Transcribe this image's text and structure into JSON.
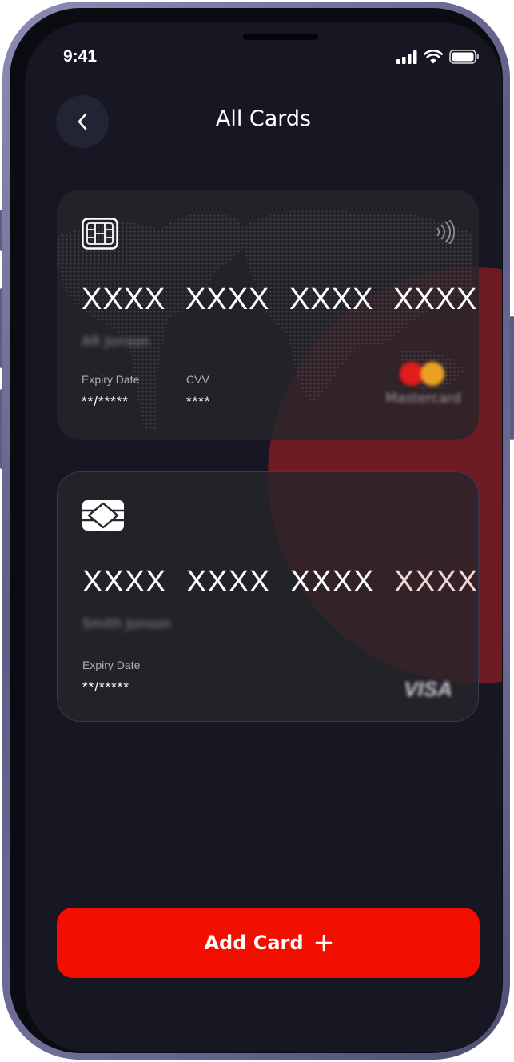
{
  "status_bar": {
    "time": "9:41"
  },
  "header": {
    "title": "All Cards"
  },
  "cards": [
    {
      "number_groups": [
        "XXXX",
        "XXXX",
        "XXXX",
        "XXXX"
      ],
      "holder": "AR Jonson",
      "expiry_label": "Expiry Date",
      "expiry_value": "**/*****",
      "cvv_label": "CVV",
      "cvv_value": "****",
      "brand": "Mastercard"
    },
    {
      "number_groups": [
        "XXXX",
        "XXXX",
        "XXXX",
        "XXXX"
      ],
      "holder": "Smith Jonson",
      "expiry_label": "Expiry Date",
      "expiry_value": "**/*****",
      "brand": "VISA"
    }
  ],
  "footer": {
    "add_card_label": "Add Card"
  },
  "colors": {
    "accent": "#f20f00",
    "background": "#161722",
    "card": "#26262c",
    "glow": "#6c1c22"
  }
}
